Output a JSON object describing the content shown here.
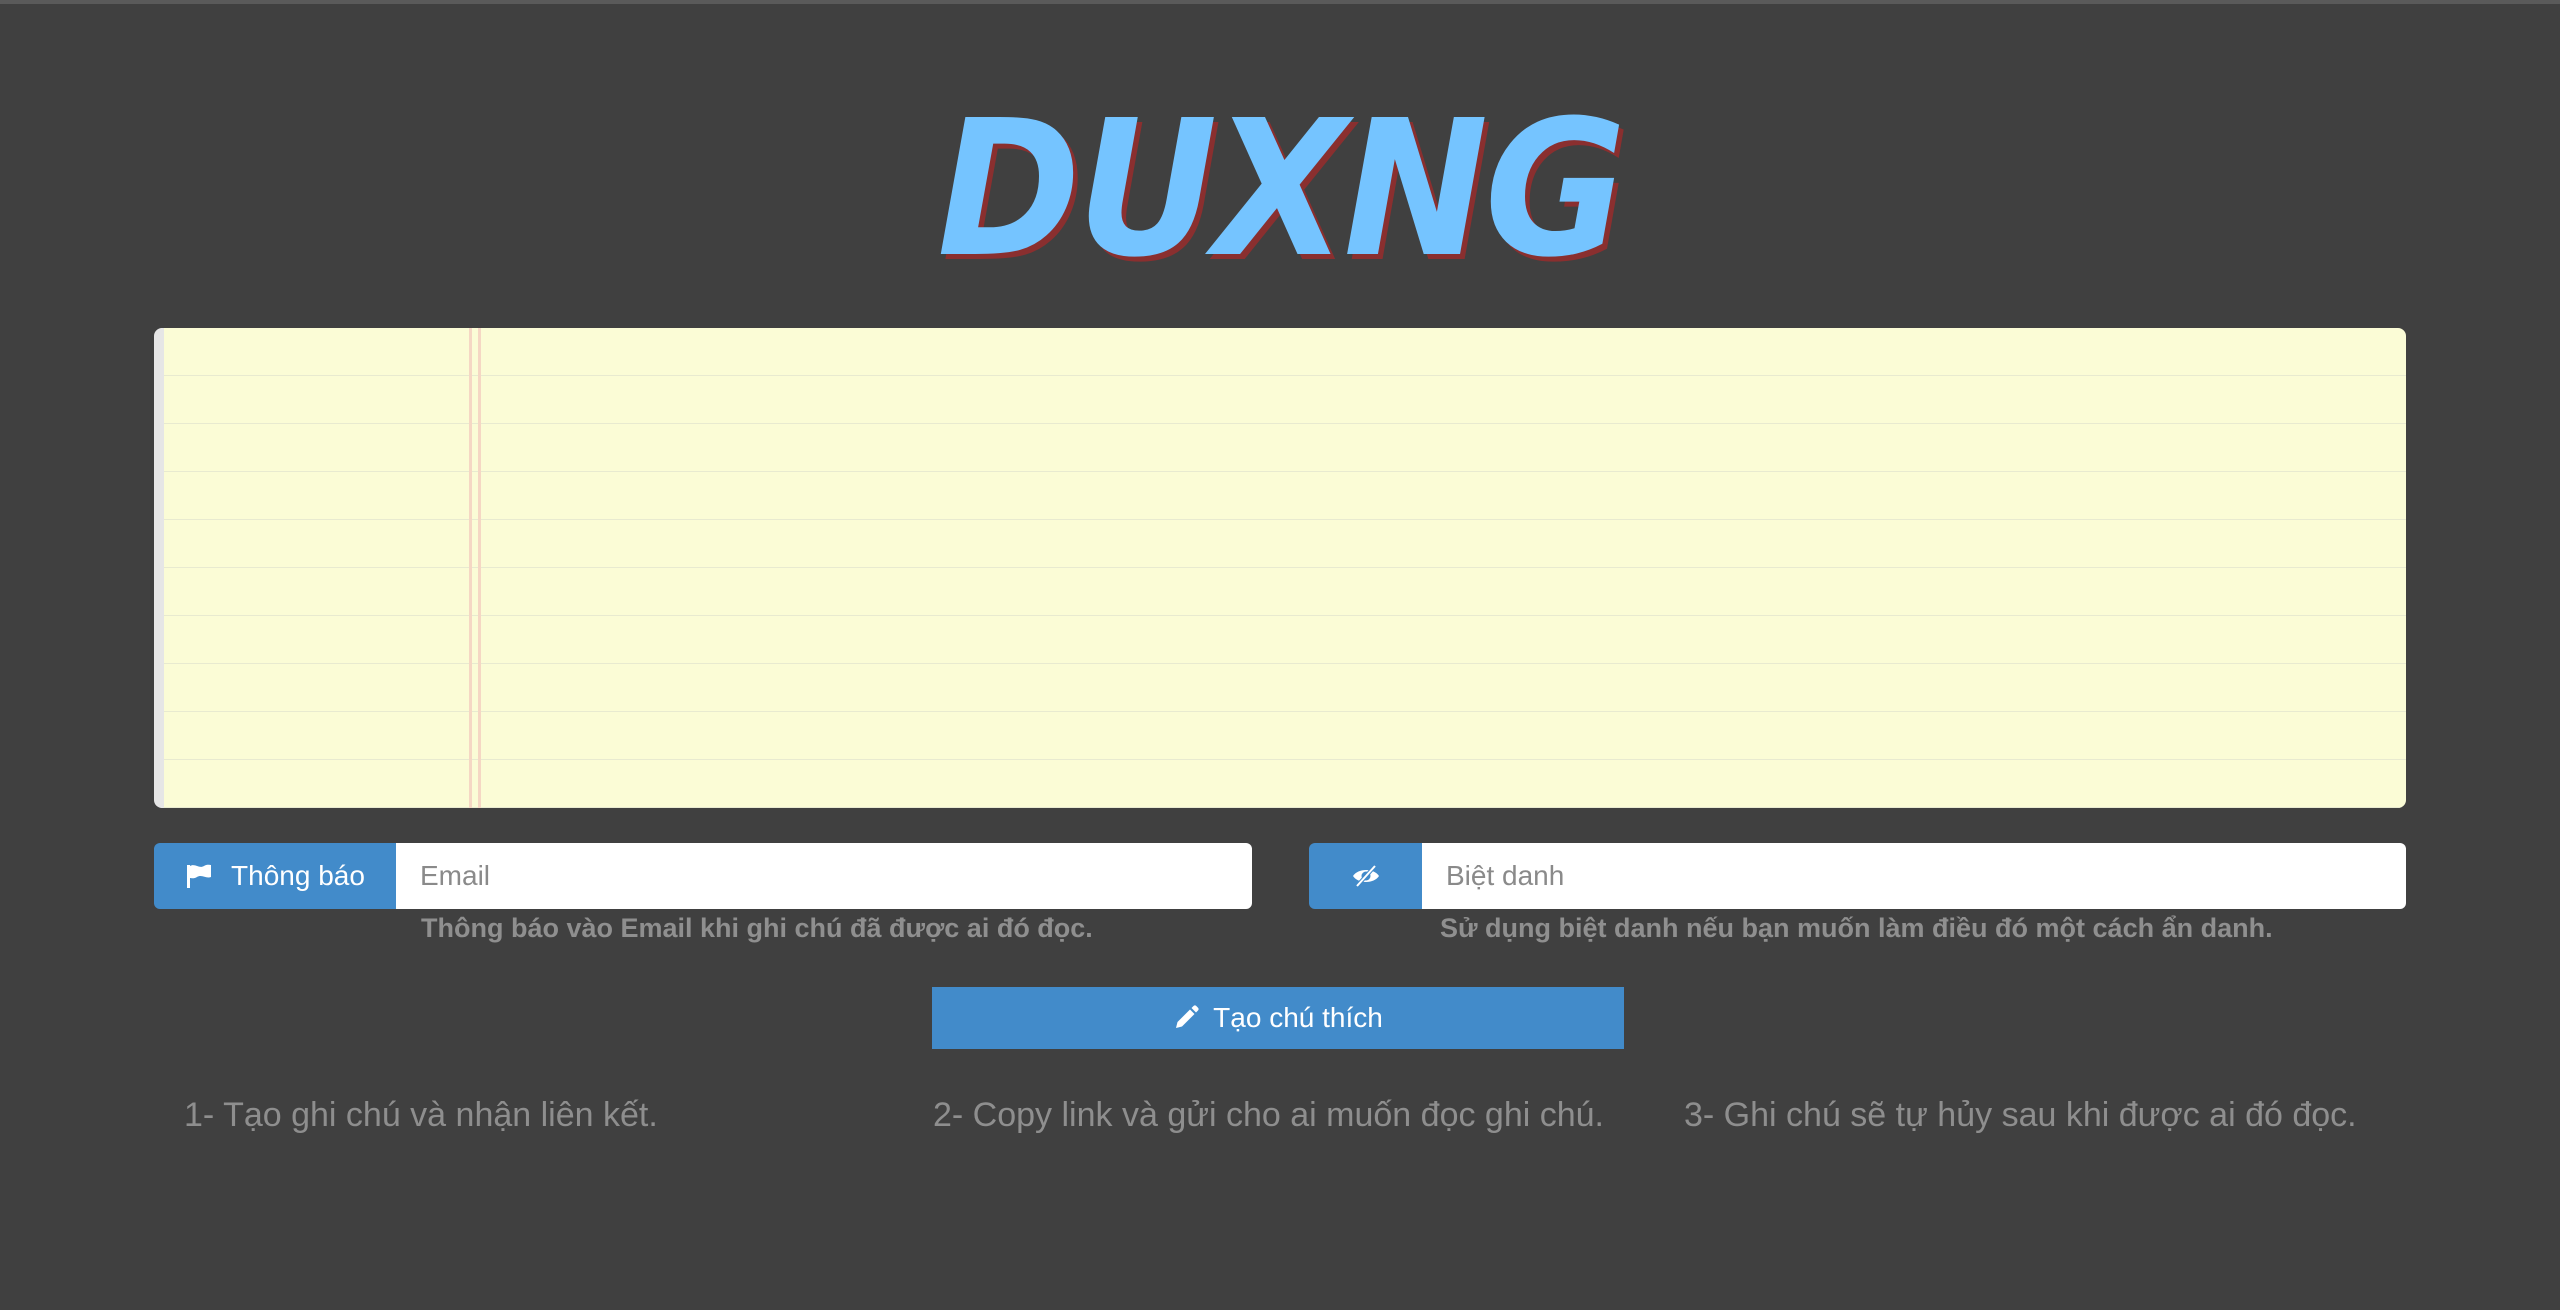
{
  "logo": {
    "text": "DUXNG"
  },
  "note": {
    "value": "",
    "placeholder": ""
  },
  "notify": {
    "addon_label": "Thông báo",
    "addon_icon": "flag-icon",
    "email_placeholder": "Email",
    "email_value": "",
    "help_text": "Thông báo vào Email khi ghi chú đã được ai đó đọc."
  },
  "nickname": {
    "addon_icon": "eye-slash-icon",
    "placeholder": "Biệt danh",
    "value": "",
    "help_text": "Sử dụng biệt danh nếu bạn muốn làm điều đó một cách ẩn danh."
  },
  "create_button": {
    "label": "Tạo chú thích",
    "icon": "pencil-icon"
  },
  "steps": [
    "1- Tạo ghi chú và nhận liên kết.",
    "2- Copy link và gửi cho ai muốn đọc ghi chú.",
    "3- Ghi chú sẽ tự hủy sau khi được ai đó đọc."
  ],
  "colors": {
    "background": "#404040",
    "accent": "#428bca",
    "logo": "#75c4ff",
    "logo_shadow": "#8a2f2f",
    "note_paper": "#fbfcd6"
  }
}
